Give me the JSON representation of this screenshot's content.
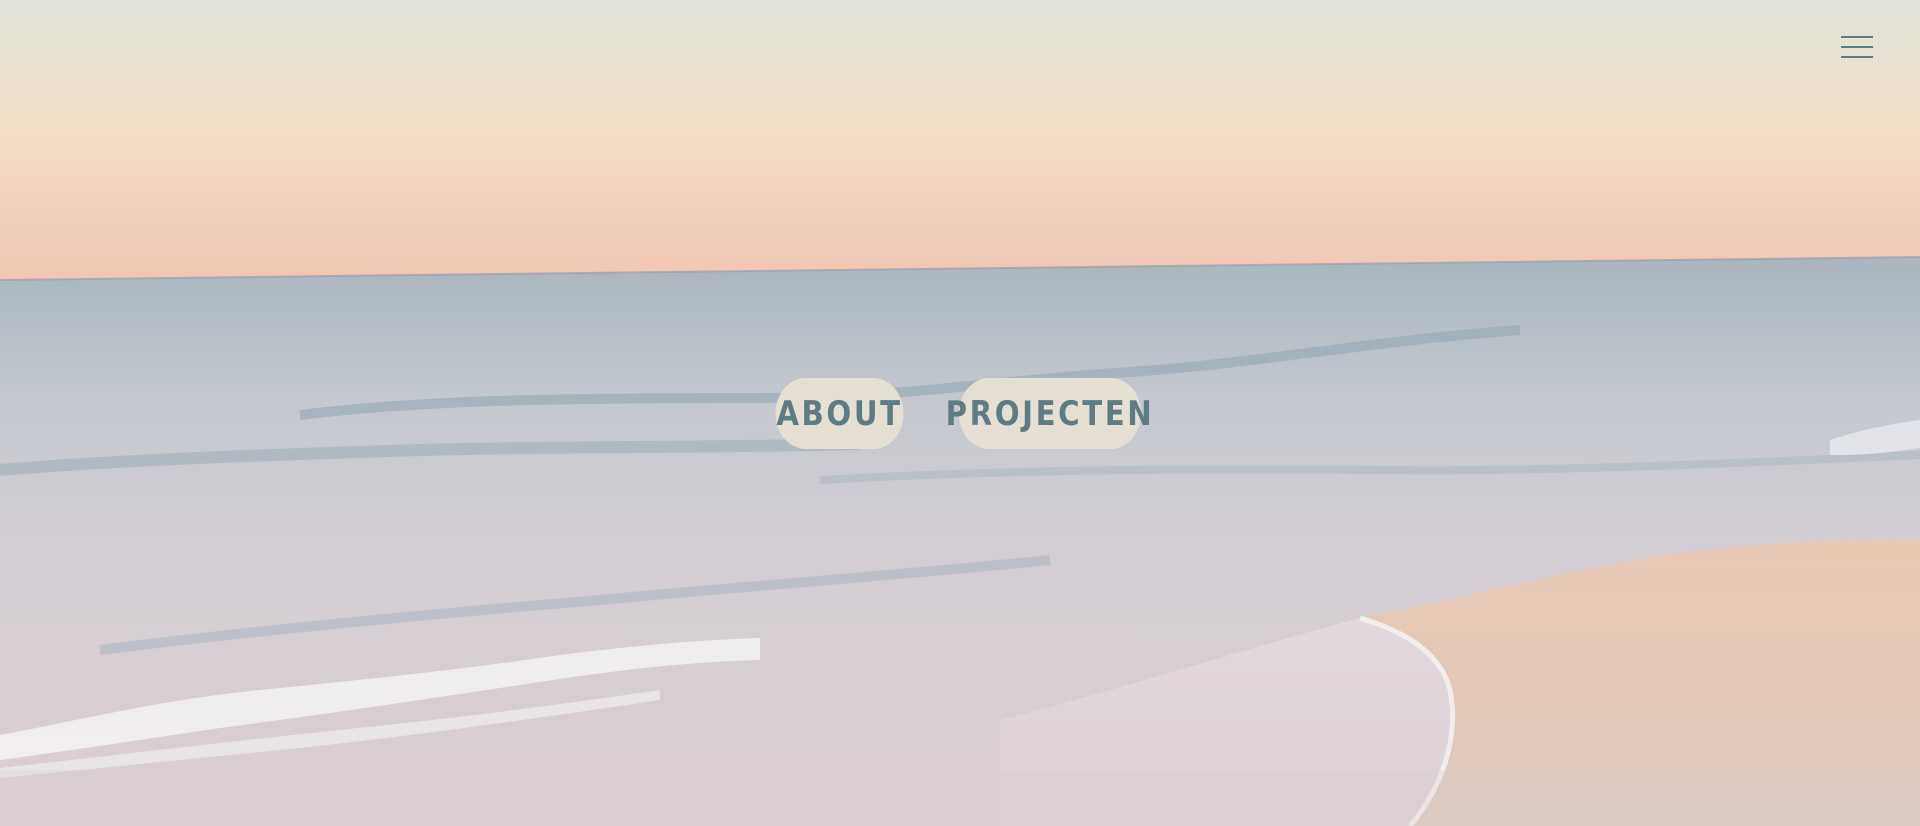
{
  "header": {
    "menu_icon": "hamburger-menu-icon"
  },
  "nav": {
    "about_label": "ABOUT",
    "projects_label": "PROJECTEN"
  },
  "colors": {
    "sky_top": "#e3e3da",
    "sky_horizon": "#f1c8b6",
    "sea": "#b6c2cb",
    "sand": "#e7c9b5",
    "button_bg": "#e8e2d4",
    "button_text": "#5f7b84",
    "menu_icon": "#5e7c86"
  }
}
